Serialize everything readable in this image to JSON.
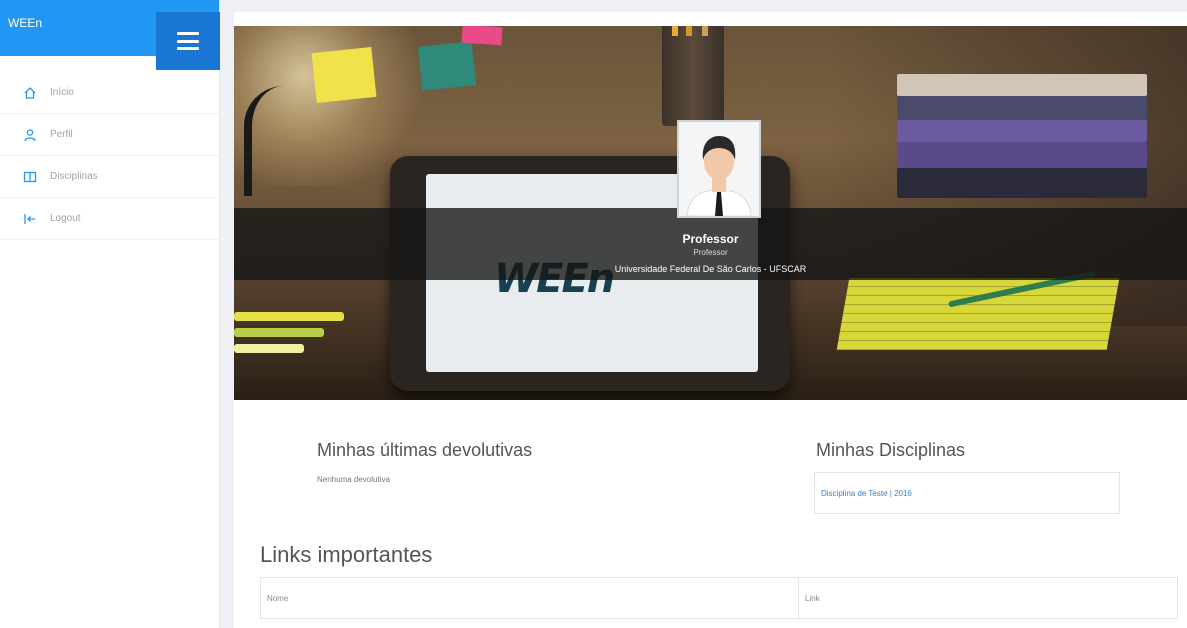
{
  "app": {
    "brand": "WEEn"
  },
  "sidebar": {
    "items": [
      {
        "label": "Início",
        "icon": "home-icon"
      },
      {
        "label": "Perfil",
        "icon": "user-icon"
      },
      {
        "label": "Disciplinas",
        "icon": "book-icon"
      },
      {
        "label": "Logout",
        "icon": "logout-icon"
      }
    ]
  },
  "profile": {
    "name": "Professor",
    "role": "Professor",
    "university": "Universidade Federal De São Carlos - UFSCAR"
  },
  "banner": {
    "logo_text": "WEEn"
  },
  "devolutivas": {
    "title": "Minhas últimas devolutivas",
    "empty_text": "Nenhuma devolutiva"
  },
  "disciplinas": {
    "title": "Minhas Disciplinas",
    "items": [
      "Disciplina de Teste | 2016"
    ]
  },
  "links": {
    "title": "Links importantes",
    "columns": [
      "Nome",
      "Link"
    ]
  },
  "colors": {
    "primary": "#2196f3",
    "primary_dark": "#1976d2",
    "link": "#3f7fbf"
  }
}
